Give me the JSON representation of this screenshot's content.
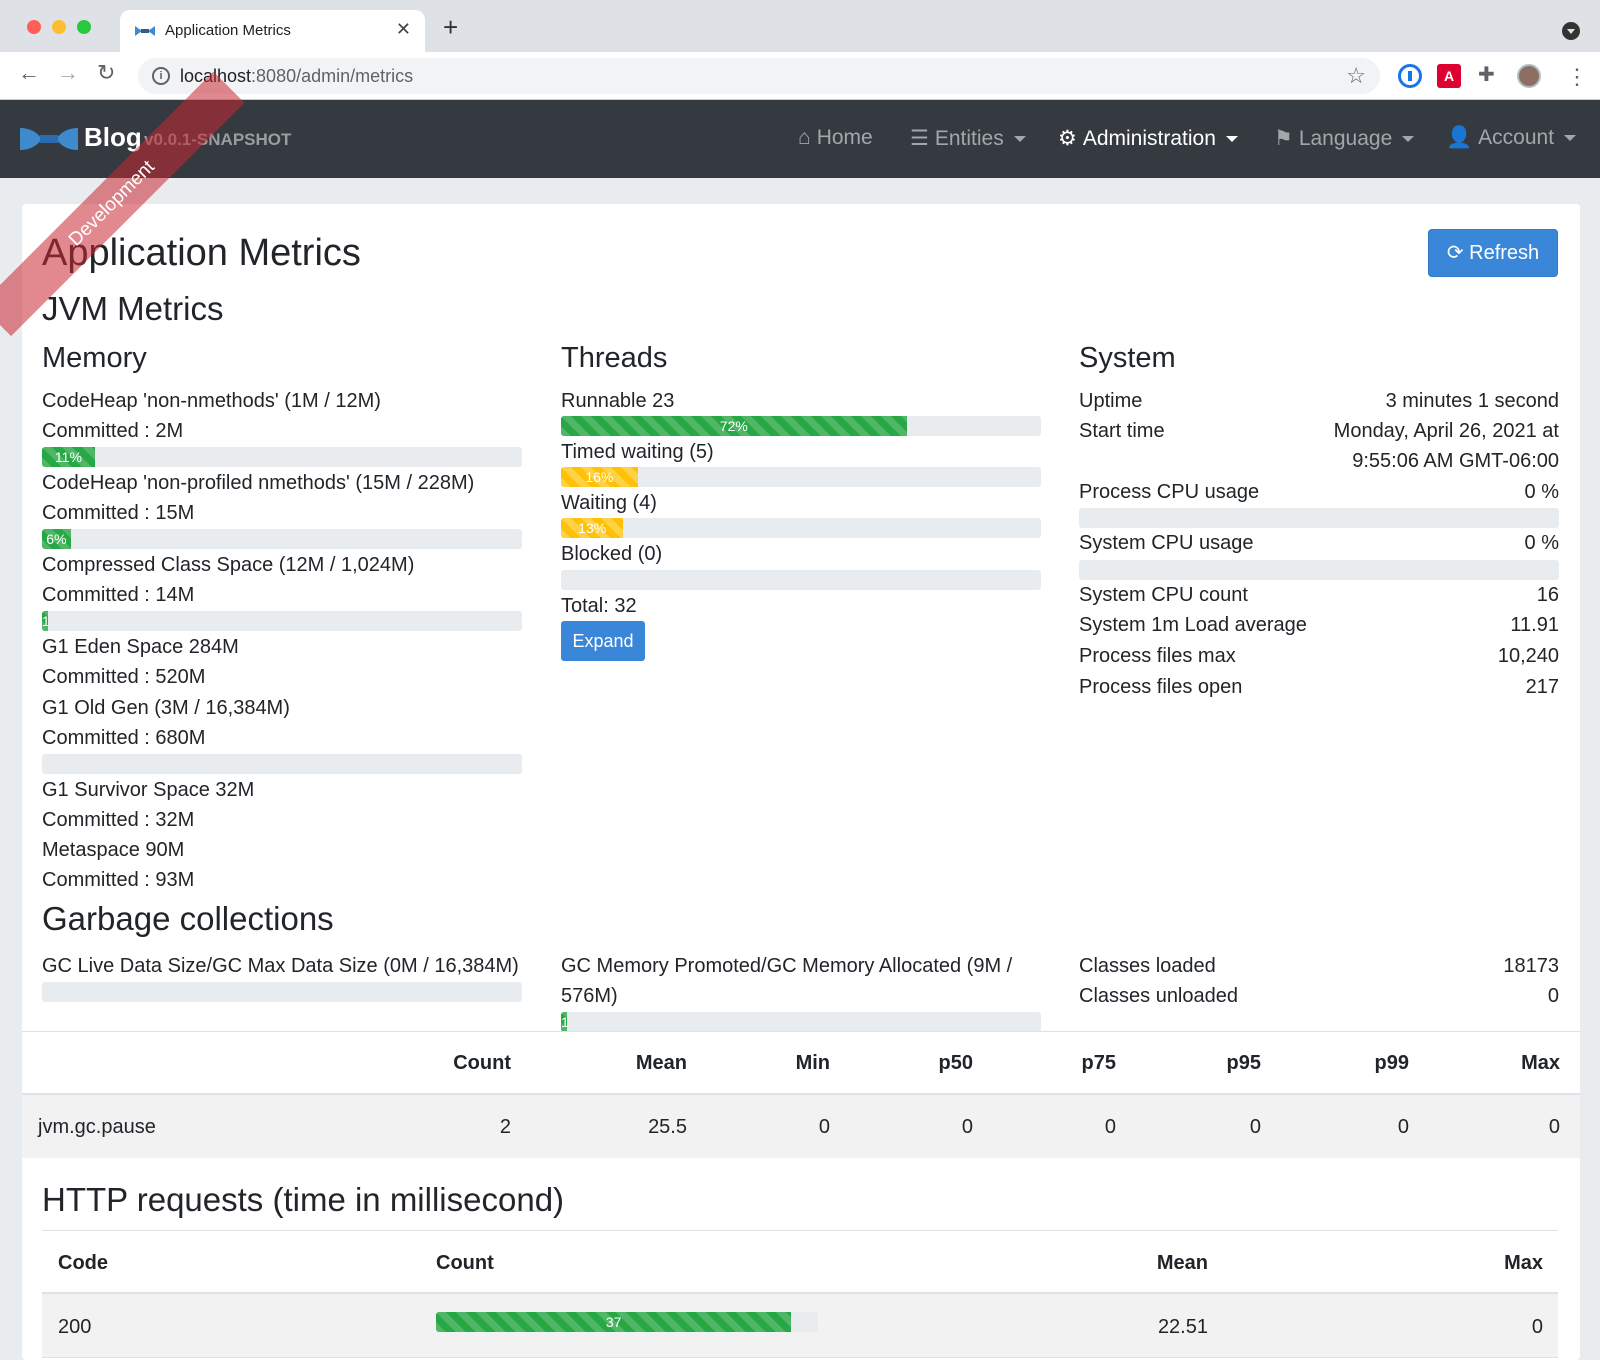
{
  "browser": {
    "tab_title": "Application Metrics",
    "tab_close": "✕",
    "new_tab": "+",
    "url_host": "localhost",
    "url_rest": ":8080/admin/metrics",
    "back": "←",
    "forward": "→",
    "reload": "↻",
    "star": "☆",
    "more": "⋮"
  },
  "navbar": {
    "brand": "Blog",
    "version": "v0.0.1-SNAPSHOT",
    "ribbon": "Development",
    "items": [
      {
        "label": "Home",
        "icon": "home-icon"
      },
      {
        "label": "Entities",
        "icon": "list-icon"
      },
      {
        "label": "Administration",
        "icon": "users-cog-icon"
      },
      {
        "label": "Language",
        "icon": "flag-icon"
      },
      {
        "label": "Account",
        "icon": "user-icon"
      }
    ]
  },
  "page": {
    "title": "Application Metrics",
    "refresh_label": "Refresh",
    "jvm_title": "JVM Metrics"
  },
  "memory": {
    "title": "Memory",
    "items": [
      {
        "label": "CodeHeap 'non-nmethods' (1M / 12M)",
        "committed": "Committed : 2M",
        "percent_label": "11%",
        "percent": 11
      },
      {
        "label": "CodeHeap 'non-profiled nmethods' (15M / 228M)",
        "committed": "Committed : 15M",
        "percent_label": "6%",
        "percent": 6
      },
      {
        "label": "Compressed Class Space (12M / 1,024M)",
        "committed": "Committed : 14M",
        "percent_label": "1",
        "percent": 1
      },
      {
        "label": "G1 Eden Space 284M",
        "committed": "Committed : 520M"
      },
      {
        "label": "G1 Old Gen (3M / 16,384M)",
        "committed": "Committed : 680M",
        "percent_label": "",
        "percent": 0
      },
      {
        "label": "G1 Survivor Space 32M",
        "committed": "Committed : 32M"
      },
      {
        "label": "Metaspace 90M",
        "committed": "Committed : 93M"
      }
    ]
  },
  "threads": {
    "title": "Threads",
    "items": [
      {
        "label": "Runnable 23",
        "percent_label": "72%",
        "percent": 72,
        "color": "#28a745"
      },
      {
        "label": "Timed waiting (5)",
        "percent_label": "16%",
        "percent": 16,
        "color": "#ffc107"
      },
      {
        "label": "Waiting (4)",
        "percent_label": "13%",
        "percent": 13,
        "color": "#ffc107"
      },
      {
        "label": "Blocked (0)",
        "percent_label": "",
        "percent": 0,
        "color": "#dc3545"
      }
    ],
    "total": "Total: 32",
    "expand_label": "Expand"
  },
  "system": {
    "title": "System",
    "uptime_label": "Uptime",
    "uptime_value": "3 minutes 1 second",
    "start_label": "Start time",
    "start_value_1": "Monday, April 26, 2021 at",
    "start_value_2": "9:55:06 AM GMT-06:00",
    "proc_cpu_label": "Process CPU usage",
    "proc_cpu_value": "0 %",
    "proc_cpu_percent": 0,
    "sys_cpu_label": "System CPU usage",
    "sys_cpu_value": "0 %",
    "sys_cpu_percent": 0,
    "cpu_count_label": "System CPU count",
    "cpu_count_value": "16",
    "load_label": "System 1m Load average",
    "load_value": "11.91",
    "files_max_label": "Process files max",
    "files_max_value": "10,240",
    "files_open_label": "Process files open",
    "files_open_value": "217"
  },
  "gc": {
    "title": "Garbage collections",
    "live_label": "GC Live Data Size/GC Max Data Size (0M / 16,384M)",
    "live_percent": 0,
    "promoted_label_1": "GC Memory Promoted/GC Memory Allocated (9M /",
    "promoted_label_2": "576M)",
    "promoted_percent_label": "1",
    "promoted_percent": 1,
    "classes_loaded_label": "Classes loaded",
    "classes_loaded_value": "18173",
    "classes_unloaded_label": "Classes unloaded",
    "classes_unloaded_value": "0",
    "table_headers": [
      "Count",
      "Mean",
      "Min",
      "p50",
      "p75",
      "p95",
      "p99",
      "Max"
    ],
    "rows": [
      {
        "name": "jvm.gc.pause",
        "values": [
          "2",
          "25.5",
          "0",
          "0",
          "0",
          "0",
          "0",
          "0"
        ]
      }
    ]
  },
  "http": {
    "title": "HTTP requests (time in millisecond)",
    "headers": {
      "code": "Code",
      "count": "Count",
      "mean": "Mean",
      "max": "Max"
    },
    "rows": [
      {
        "code": "200",
        "count": "37",
        "count_percent": 93,
        "mean": "22.51",
        "max": "0"
      }
    ]
  }
}
